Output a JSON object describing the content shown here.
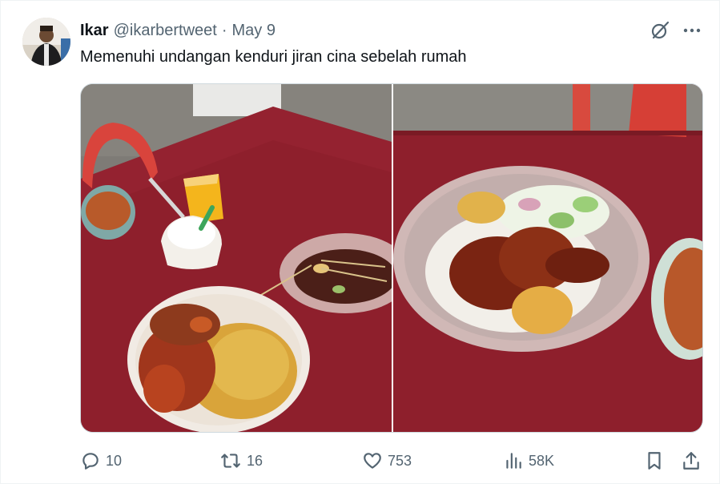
{
  "tweet": {
    "author_name": "Ikar",
    "handle": "@ikarbertweet",
    "separator": "·",
    "date": "May 9",
    "text": "Memenuhi undangan kenduri jiran cina sebelah rumah"
  },
  "media": {
    "photos": [
      {
        "icon": "photo"
      },
      {
        "icon": "photo"
      }
    ]
  },
  "actions": {
    "replies": "10",
    "reposts": "16",
    "likes": "753",
    "views": "58K"
  },
  "icons": {
    "grok": "grok-icon",
    "more": "more-icon",
    "reply": "reply-icon",
    "repost": "repost-icon",
    "like": "heart-icon",
    "views": "views-icon",
    "bookmark": "bookmark-icon",
    "share": "share-icon"
  },
  "colors": {
    "text_primary": "#0f1419",
    "text_secondary": "#536471",
    "tablecloth": "#8e1f2c"
  }
}
